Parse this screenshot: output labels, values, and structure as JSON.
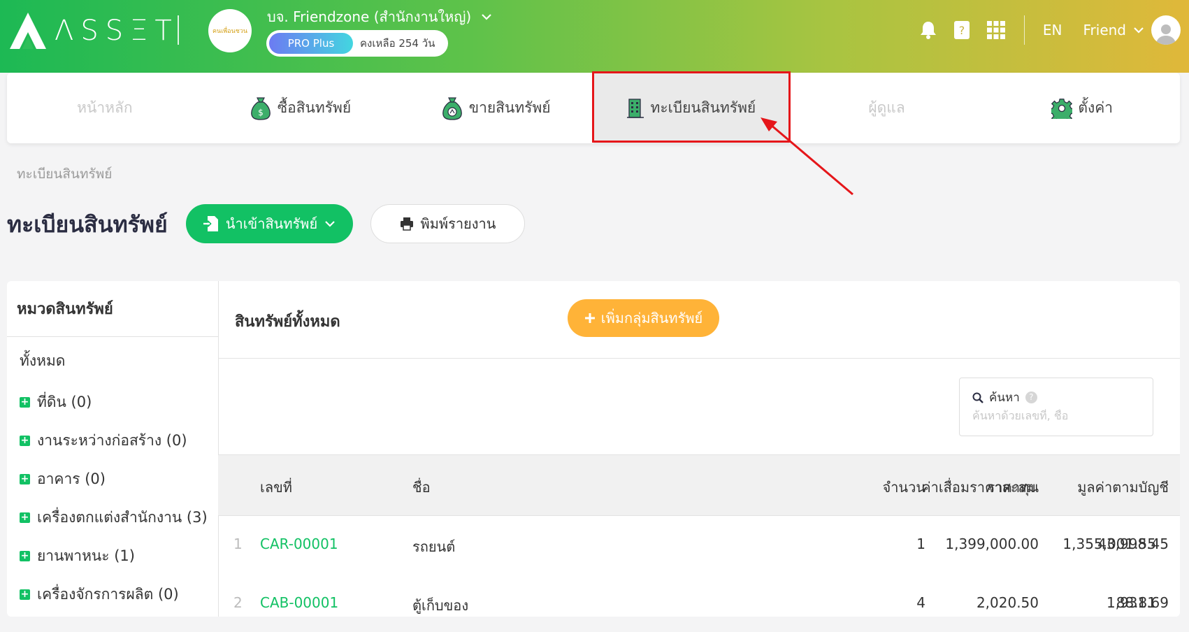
{
  "brand": {
    "logo_text": "ΛSSΞT"
  },
  "company": {
    "name": "บจ. Friendzone (สำนักงานใหญ่)",
    "logo_text": "คนเพื่อนชวน"
  },
  "plan": {
    "badge": "PRO Plus",
    "remaining": "คงเหลือ 254 วัน"
  },
  "topbar": {
    "lang": "EN",
    "user": "Friend"
  },
  "nav": {
    "items": [
      {
        "label": "หน้าหลัก",
        "icon": ""
      },
      {
        "label": "ซื้อสินทรัพย์",
        "icon": "money-bag-icon"
      },
      {
        "label": "ขายสินทรัพย์",
        "icon": "money-bag-sell-icon"
      },
      {
        "label": "ทะเบียนสินทรัพย์",
        "icon": "building-icon"
      },
      {
        "label": "ผู้ดูแล",
        "icon": ""
      },
      {
        "label": "ตั้งค่า",
        "icon": "gear-icon"
      }
    ]
  },
  "breadcrumb": "ทะเบียนสินทรัพย์",
  "page": {
    "title": "ทะเบียนสินทรัพย์",
    "import_label": "นำเข้าสินทรัพย์",
    "print_label": "พิมพ์รายงาน"
  },
  "sidebar": {
    "title": "หมวดสินทรัพย์",
    "all_label": "ทั้งหมด",
    "categories": [
      {
        "label": "ที่ดิน (0)"
      },
      {
        "label": "งานระหว่างก่อสร้าง (0)"
      },
      {
        "label": "อาคาร (0)"
      },
      {
        "label": "เครื่องตกแต่งสำนักงาน (3)"
      },
      {
        "label": "ยานพาหนะ (1)"
      },
      {
        "label": "เครื่องจักรการผลิต (0)"
      }
    ]
  },
  "main": {
    "title": "สินทรัพย์ทั้งหมด",
    "add_group_label": "เพิ่มกลุ่มสินทรัพย์",
    "search": {
      "label": "ค้นหา",
      "placeholder": "ค้นหาด้วยเลขที่, ชื่อ"
    }
  },
  "table": {
    "headers": {
      "code": "เลขที่",
      "name": "ชื่อ",
      "qty": "จำนวน",
      "cost": "ราคาทุน",
      "depr": "ค่าเสื่อมราคาสะสม",
      "book": "มูลค่าตามบัญชี"
    },
    "rows": [
      {
        "idx": "1",
        "code": "CAR-00001",
        "name": "รถยนต์",
        "qty": "1",
        "cost": "1,399,000.00",
        "depr": "1,355,001.55",
        "book": "43,998.45"
      },
      {
        "idx": "2",
        "code": "CAB-00001",
        "name": "ตู้เก็บของ",
        "qty": "4",
        "cost": "2,020.50",
        "depr": "88.81",
        "book": "1,931.69"
      }
    ]
  },
  "colors": {
    "green": "#12c164",
    "orange": "#ffb338",
    "highlight": "#e5161a"
  }
}
